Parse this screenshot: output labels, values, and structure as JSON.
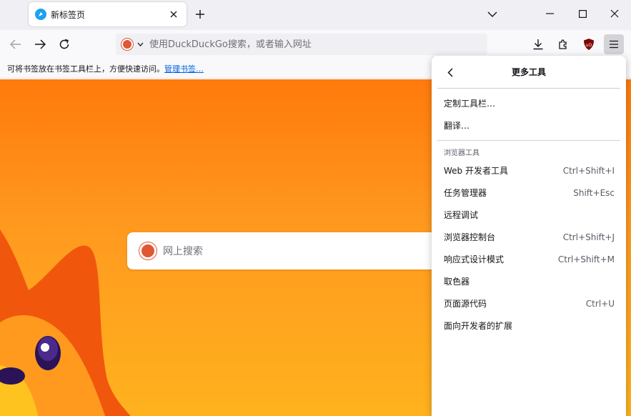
{
  "tab": {
    "title": "新标签页"
  },
  "urlbar": {
    "placeholder": "使用DuckDuckGo搜索，或者输入网址"
  },
  "bookmarks": {
    "message": "可将书签放在书签工具栏上，方便快速访问。",
    "manage_link": "管理书签…"
  },
  "content": {
    "search_placeholder": "网上搜索"
  },
  "panel": {
    "title": "更多工具",
    "top_items": [
      {
        "label": "定制工具栏…"
      },
      {
        "label": "翻译…"
      }
    ],
    "section_label": "浏览器工具",
    "tools": [
      {
        "label": "Web 开发者工具",
        "shortcut": "Ctrl+Shift+I"
      },
      {
        "label": "任务管理器",
        "shortcut": "Shift+Esc"
      },
      {
        "label": "远程调试",
        "shortcut": ""
      },
      {
        "label": "浏览器控制台",
        "shortcut": "Ctrl+Shift+J"
      },
      {
        "label": "响应式设计模式",
        "shortcut": "Ctrl+Shift+M"
      },
      {
        "label": "取色器",
        "shortcut": ""
      },
      {
        "label": "页面源代码",
        "shortcut": "Ctrl+U"
      },
      {
        "label": "面向开发者的扩展",
        "shortcut": ""
      }
    ]
  },
  "colors": {
    "accent_link": "#0061e0",
    "ddg": "#de5833",
    "ublock": "#800000",
    "bg_gradient_top": "#ff7a0c",
    "bg_gradient_bottom": "#ffb21e"
  },
  "icons": [
    "firefox-favicon-icon",
    "close-icon",
    "plus-icon",
    "chevron-down-icon",
    "minimize-icon",
    "maximize-icon",
    "window-close-icon",
    "back-arrow-icon",
    "forward-arrow-icon",
    "reload-icon",
    "duckduckgo-icon",
    "download-icon",
    "extensions-icon",
    "ublock-origin-icon",
    "hamburger-menu-icon",
    "panel-back-icon"
  ]
}
